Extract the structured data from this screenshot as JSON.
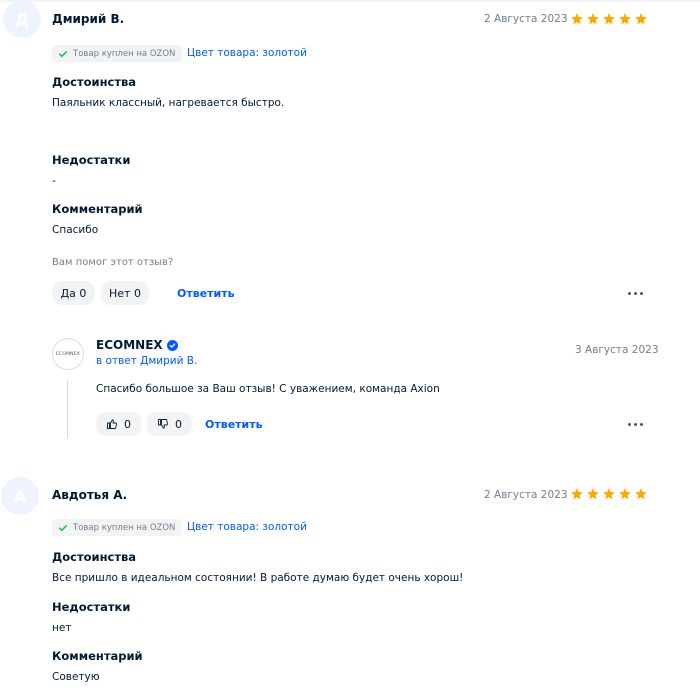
{
  "reviews": [
    {
      "avatar_letter": "Д",
      "author": "Дмирий В.",
      "date": "2 Августа 2023",
      "rating": 5,
      "purchase_badge": "Товар куплен на OZON",
      "color_label": "Цвет товара: золотой",
      "pros_title": "Достоинства",
      "pros": "Паяльник классный, нагревается быстро.",
      "cons_title": "Недостатки",
      "cons": "-",
      "comment_title": "Комментарий",
      "comment": "Спасибо",
      "helpful_question": "Вам помог этот отзыв?",
      "yes_label": "Да 0",
      "no_label": "Нет 0",
      "reply_label": "Ответить"
    },
    {
      "avatar_letter": "А",
      "author": "Авдотья А.",
      "date": "2 Августа 2023",
      "rating": 5,
      "purchase_badge": "Товар куплен на OZON",
      "color_label": "Цвет товара: золотой",
      "pros_title": "Достоинства",
      "pros": "Все пришло в идеальном состоянии! В работе думаю будет очень хорош!",
      "cons_title": "Недостатки",
      "cons": "нет",
      "comment_title": "Комментарий",
      "comment": "Советую"
    }
  ],
  "seller_reply": {
    "logo_text": "ECOMNEX",
    "seller_name": "ECOMNEX",
    "in_reply_to": "в ответ Дмирий В.",
    "date": "3 Августа 2023",
    "text": "Спасибо большое за Ваш отзыв! С уважением, команда Axion",
    "likes": "0",
    "dislikes": "0",
    "reply_label": "Ответить"
  },
  "colors": {
    "accent": "#005bff",
    "star": "#ffa800",
    "check": "#10c44c",
    "text_primary": "#001a34",
    "text_secondary": "#707f8d",
    "pill_bg": "#f2f3f5",
    "avatar_bg": "#eef4ff"
  },
  "icons": [
    "star-icon",
    "check-icon",
    "verified-icon",
    "thumbs-up-icon",
    "thumbs-down-icon",
    "more-dots-icon"
  ]
}
